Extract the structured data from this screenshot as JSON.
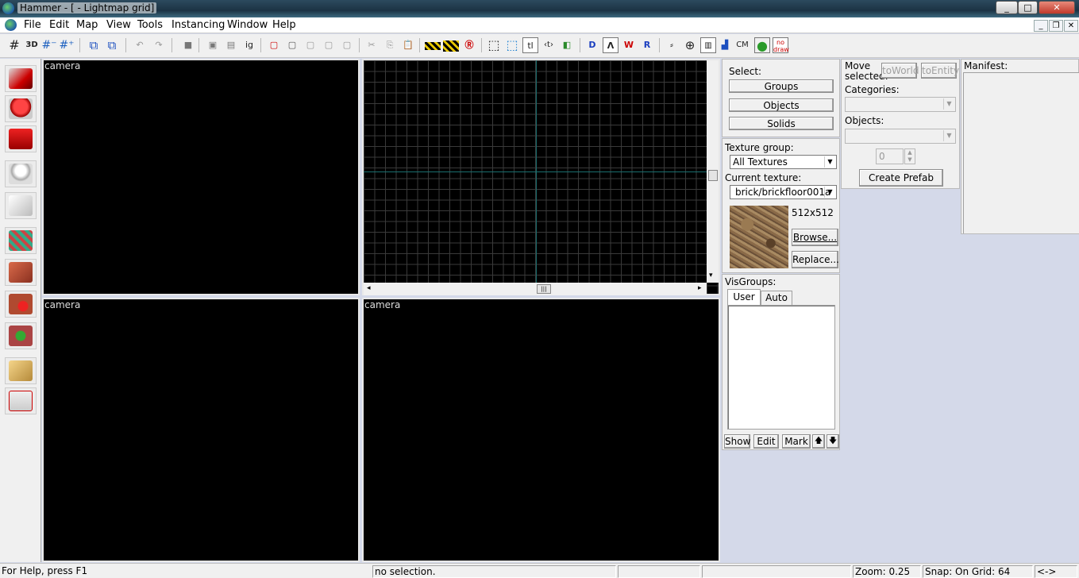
{
  "window": {
    "title": "Hammer - [ - Lightmap grid]",
    "controls": [
      "_",
      "□",
      "✕"
    ],
    "mdi_controls": [
      "_",
      "❐",
      "✕"
    ]
  },
  "menu": [
    "File",
    "Edit",
    "Map",
    "View",
    "Tools",
    "Instancing",
    "Window",
    "Help"
  ],
  "toolbar": {
    "grid_3d_label": "3D",
    "texture_lock_label": "tl",
    "cm_label": "CM",
    "nodraw_label": "no draw",
    "icons": [
      "grid-icon",
      "3d-grid-icon",
      "smaller-grid-icon",
      "larger-grid-icon",
      "group-icon",
      "ungroup-icon",
      "undo-icon",
      "redo-icon",
      "carve-icon",
      "hollow-icon",
      "clip-icon",
      "ignore-groups-icon",
      "hide-selected-icon",
      "hide-unselected-icon",
      "show-all-icon",
      "cut-icon",
      "copy-icon",
      "paste-icon",
      "toggle-helpers-icon",
      "toggle-models-icon",
      "radius-culling-icon",
      "selection-box-icon",
      "auto-select-icon",
      "texture-lock-icon",
      "texture-scale-lock-icon",
      "flip-icon",
      "camera-icon",
      "3d-textured-icon",
      "3d-wireframe-icon",
      "3d-flat-icon",
      "snap-icon",
      "run-map-icon",
      "cordon-icon",
      "entity-icon",
      "cubemap-icon",
      "leaf-icon",
      "nodraw-icon"
    ]
  },
  "left_tools": [
    "selection-tool-icon",
    "magnify-tool-icon",
    "camera-tool-icon",
    "entity-tool-icon",
    "block-tool-icon",
    "texture-application-icon",
    "apply-current-texture-icon",
    "decal-tool-icon",
    "overlay-tool-icon",
    "clipping-tool-icon",
    "vertex-tool-icon"
  ],
  "viewports": {
    "top_left": "camera",
    "bottom_left": "camera",
    "bottom_right": "camera"
  },
  "select_panel": {
    "label": "Select:",
    "groups": "Groups",
    "objects": "Objects",
    "solids": "Solids"
  },
  "texture_panel": {
    "group_label": "Texture group:",
    "group_value": "All Textures",
    "current_label": "Current texture:",
    "current_value": "brick/brickfloor001a",
    "size": "512x512",
    "browse": "Browse...",
    "replace": "Replace..."
  },
  "visgroups": {
    "label": "VisGroups:",
    "tabs": [
      "User",
      "Auto"
    ],
    "show": "Show",
    "edit": "Edit",
    "mark": "Mark",
    "up": "🡅",
    "down": "🡇"
  },
  "move_panel": {
    "label_line1": "Move",
    "label_line2": "selected:",
    "to_world": "toWorld",
    "to_entity": "toEntity",
    "categories_label": "Categories:",
    "objects_label": "Objects:",
    "spinner_value": "0",
    "create_prefab": "Create Prefab"
  },
  "manifest": {
    "label": "Manifest:"
  },
  "status": {
    "help": "For Help, press F1",
    "selection": "no selection.",
    "zoom": "Zoom: 0.25",
    "snap": "Snap: On Grid: 64",
    "extra": "<->"
  },
  "colors": {
    "accent_background": "#d4d9e9",
    "viewport_background": "#000000",
    "grid_line": "#3a3a3a",
    "axis_line": "#1a6e6e"
  }
}
